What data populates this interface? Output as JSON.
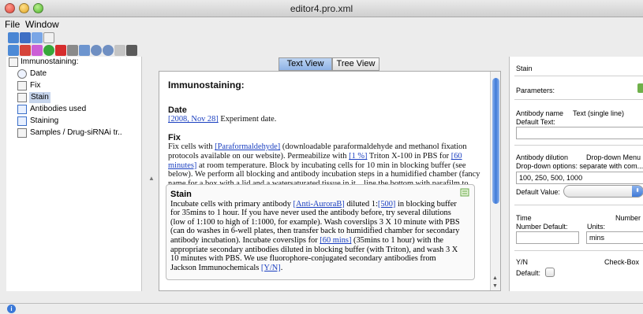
{
  "window": {
    "title": "editor4.pro.xml"
  },
  "menu": {
    "file": "File",
    "window": "Window"
  },
  "toolbar_icons": [
    "folder-icon",
    "save-icon",
    "edit-icon",
    "new-doc-icon",
    "checklist-icon",
    "undo-icon",
    "draw-icon",
    "add-icon",
    "delete-icon",
    "grey-box-icon",
    "export-icon",
    "move-up-icon",
    "move-down-icon",
    "copy-icon",
    "trash-icon"
  ],
  "tree": {
    "root": "Immunostaining:",
    "items": [
      {
        "label": "Date",
        "icon": "clock-icon"
      },
      {
        "label": "Fix",
        "icon": "doc-icon"
      },
      {
        "label": "Stain",
        "icon": "doc-icon",
        "selected": true
      },
      {
        "label": "Antibodies used",
        "icon": "table-icon"
      },
      {
        "label": "Staining",
        "icon": "table-icon"
      },
      {
        "label": "Samples / Drug-siRNAi tr..",
        "icon": "doc-icon"
      }
    ]
  },
  "tabs": {
    "text_view": "Text View",
    "tree_view": "Tree View"
  },
  "doc": {
    "title": "Immunostaining:",
    "date": {
      "heading": "Date",
      "link": "[2008, Nov 28]",
      "rest": " Experiment date."
    },
    "fix": {
      "heading": "Fix",
      "t1": "Fix cells with ",
      "l1": "[Paraformaldehyde]",
      "t2": " (downloadable paraformaldehyde and methanol fixation protocols available on our website). Permeabilize with ",
      "l2": "[1 %]",
      "t3": " Triton X-100 in PBS for ",
      "l3": "[60 minutes]",
      "t4": " at room temperature. Block by incubating cells for 10 min in blocking buffer (see below). We perform all blocking and antibody incubation steps in a humidified chamber (fancy name for a box with a lid and a watersaturated tissue in it…line the bottom with parafilm to put the coverslips on)."
    },
    "stain": {
      "heading": "Stain",
      "t1": "Incubate cells with primary antibody ",
      "l1": "[Anti-AuroraB]",
      "t2": " diluted 1:",
      "l2": "[500]",
      "t3": " in blocking buffer for 35mins to 1 hour. If you have never used the antibody before, try several dilutions (low of 1:100 to high of 1:1000, for example). Wash coverslips 3 X 10 minute with PBS (can do washes in 6-well plates, then transfer back to humidified chamber for secondary antibody incubation). Incubate coverslips for ",
      "l3": "[60 mins]",
      "t4": " (35mins to 1 hour) with the appropriate secondary antibodies diluted in blocking buffer (with Triton), and wash 3 X 10 minutes with PBS. We use fluorophore-conjugated secondary antibodies from Jackson Immunochemicals ",
      "l4": "[Y/N]",
      "t5": "."
    }
  },
  "props": {
    "title": "Stain",
    "parameters": "Parameters:",
    "antibody_name": "Antibody name",
    "text_type": "Text  (single line)",
    "default_text": "Default Text:",
    "antibody_dilution": "Antibody dilution",
    "dropdown_type": "Drop-down Menu",
    "dropdown_options_label": "Drop-down options: separate with com...",
    "dropdown_options_value": "100, 250, 500, 1000",
    "default_value": "Default Value:",
    "time": "Time",
    "number_type": "Number",
    "number_default": "Number Default:",
    "units": "Units:",
    "units_value": "mins",
    "yn": "Y/N",
    "checkbox_type": "Check-Box",
    "default": "Default:"
  }
}
